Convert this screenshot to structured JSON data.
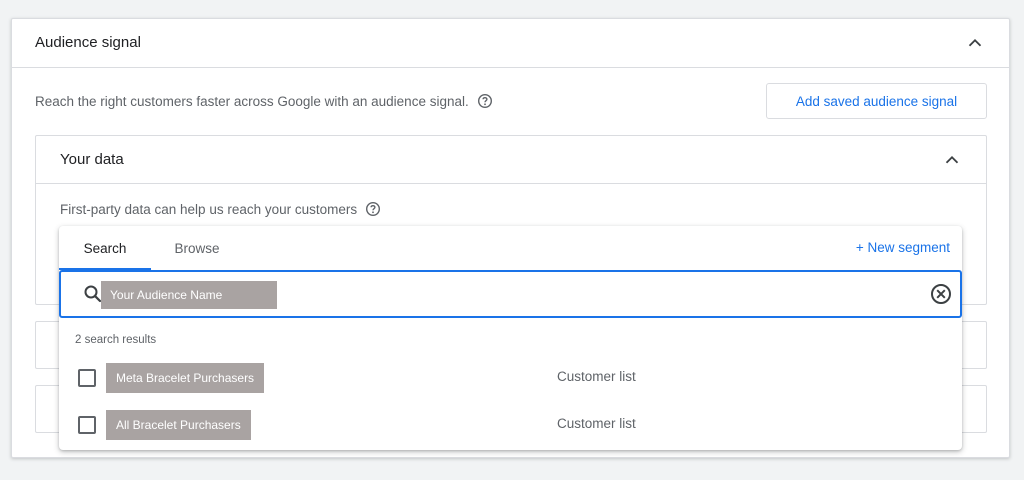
{
  "section": {
    "title": "Audience signal",
    "intro_text": "Reach the right customers faster across Google with an audience signal.",
    "add_saved_button": "Add saved audience signal"
  },
  "your_data": {
    "title": "Your data",
    "description": "First-party data can help us reach your customers"
  },
  "dropdown": {
    "tabs": [
      {
        "label": "Search",
        "active": true
      },
      {
        "label": "Browse",
        "active": false
      }
    ],
    "new_segment": "+ New segment",
    "search": {
      "value": "Your Audience Name",
      "placeholder": ""
    },
    "result_count": "2 search results",
    "results": [
      {
        "name": "Meta Bracelet Purchasers",
        "type": "Customer list",
        "checked": false
      },
      {
        "name": "All Bracelet Purchasers",
        "type": "Customer list",
        "checked": false
      }
    ]
  },
  "icons": {
    "collapse": "chevron-up-icon",
    "help": "help-circle-icon",
    "search": "search-icon",
    "clear": "clear-circle-icon"
  },
  "colors": {
    "accent": "#1a73e8",
    "redaction": "#a9a3a2",
    "border": "#dadce0",
    "text_secondary": "#5f6368"
  }
}
